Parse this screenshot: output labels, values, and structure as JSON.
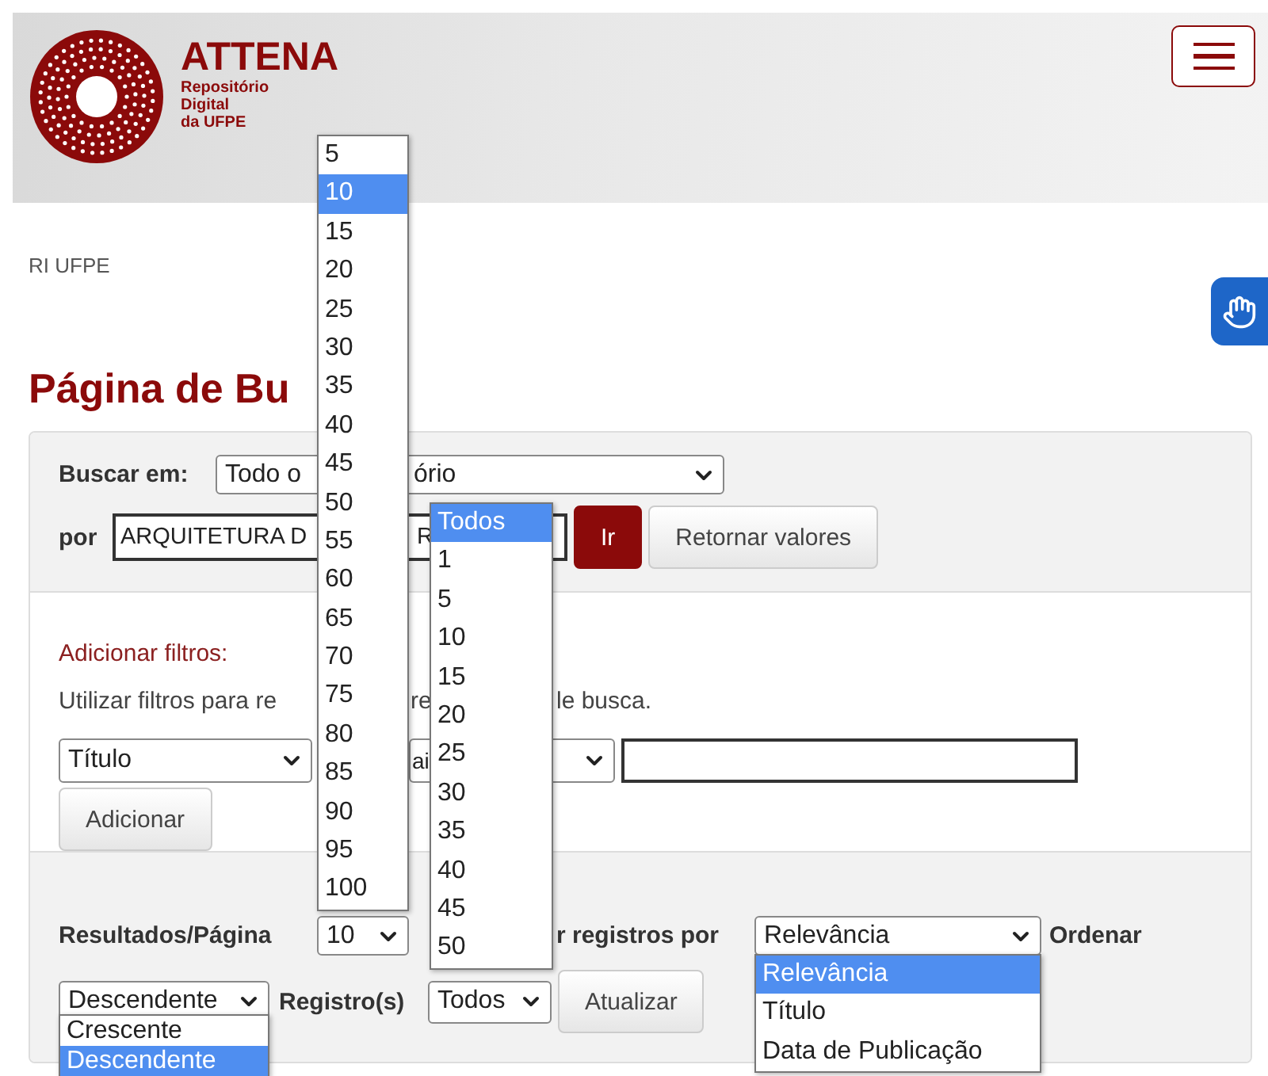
{
  "header": {
    "brand": "ATTENA",
    "subtitle": [
      "Repositório",
      "Digital",
      "da UFPE"
    ]
  },
  "breadcrumb": "RI UFPE",
  "heading": "Página de Bu",
  "search": {
    "label": "Buscar em:",
    "scope_parts": [
      "Todo o",
      "ório"
    ],
    "query_label": "por",
    "query_parts": [
      "ARQUITETURA D",
      "R"
    ],
    "go": "Ir",
    "reset": "Retornar valores"
  },
  "filters": {
    "title": "Adicionar filtros:",
    "hint_parts": [
      "Utilizar filtros para re",
      "re",
      "le busca."
    ],
    "field": "Título",
    "operator": "ai",
    "add": "Adicionar"
  },
  "controls": {
    "per_page_label": "Resultados/Página",
    "per_page": "10",
    "sort_label": "r registros por",
    "sort": "Relevância",
    "order_label": "Ordenar",
    "order": "Descendente",
    "records_label": "Registro(s)",
    "records": "Todos",
    "update": "Atualizar"
  },
  "open_lists": [
    {
      "kind": "per_page",
      "options": [
        {
          "label": "5",
          "selected": false
        },
        {
          "label": "10",
          "selected": true
        },
        {
          "label": "15",
          "selected": false
        },
        {
          "label": "20",
          "selected": false
        },
        {
          "label": "25",
          "selected": false
        },
        {
          "label": "30",
          "selected": false
        },
        {
          "label": "35",
          "selected": false
        },
        {
          "label": "40",
          "selected": false
        },
        {
          "label": "45",
          "selected": false
        },
        {
          "label": "50",
          "selected": false
        },
        {
          "label": "55",
          "selected": false
        },
        {
          "label": "60",
          "selected": false
        },
        {
          "label": "65",
          "selected": false
        },
        {
          "label": "70",
          "selected": false
        },
        {
          "label": "75",
          "selected": false
        },
        {
          "label": "80",
          "selected": false
        },
        {
          "label": "85",
          "selected": false
        },
        {
          "label": "90",
          "selected": false
        },
        {
          "label": "95",
          "selected": false
        },
        {
          "label": "100",
          "selected": false
        }
      ]
    },
    {
      "kind": "records",
      "options": [
        {
          "label": "Todos",
          "selected": true
        },
        {
          "label": "1",
          "selected": false
        },
        {
          "label": "5",
          "selected": false
        },
        {
          "label": "10",
          "selected": false
        },
        {
          "label": "15",
          "selected": false
        },
        {
          "label": "20",
          "selected": false
        },
        {
          "label": "25",
          "selected": false
        },
        {
          "label": "30",
          "selected": false
        },
        {
          "label": "35",
          "selected": false
        },
        {
          "label": "40",
          "selected": false
        },
        {
          "label": "45",
          "selected": false
        },
        {
          "label": "50",
          "selected": false
        }
      ]
    },
    {
      "kind": "order",
      "options": [
        {
          "label": "Crescente",
          "selected": false
        },
        {
          "label": "Descendente",
          "selected": true
        }
      ]
    },
    {
      "kind": "sort",
      "options": [
        {
          "label": "Relevância",
          "selected": true
        },
        {
          "label": "Título",
          "selected": false
        },
        {
          "label": "Data de Publicação",
          "selected": false
        }
      ]
    }
  ]
}
